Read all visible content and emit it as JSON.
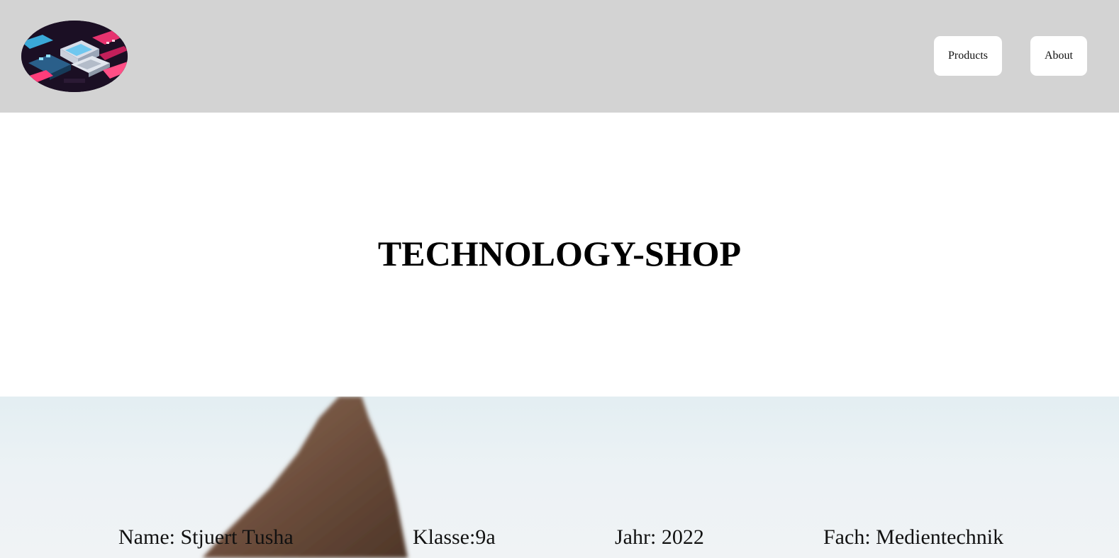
{
  "header": {
    "logo_alt": "logo",
    "nav": {
      "products_label": "Products",
      "about_label": "About"
    }
  },
  "main": {
    "title": "TECHNOLOGY-SHOP"
  },
  "footer": {
    "name": "Name: Stjuert Tusha",
    "klasse": "Klasse:9a",
    "jahr": "Jahr: 2022",
    "fach": "Fach: Medientechnik"
  },
  "colors": {
    "header_bg": "#d3d3d3",
    "button_bg": "#ffffff",
    "hero_sky": "#e8f0f3",
    "rock": "#7a5a46"
  }
}
